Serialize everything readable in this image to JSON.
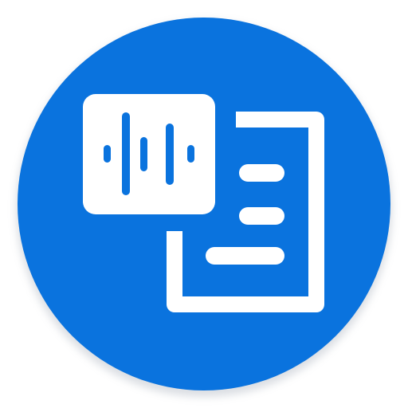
{
  "app_icon": {
    "icon_name": "voice-to-document-icon",
    "background_color": "#0A73DE",
    "foreground_color": "#FFFFFF",
    "shadow_color": "#9AA3B0"
  }
}
